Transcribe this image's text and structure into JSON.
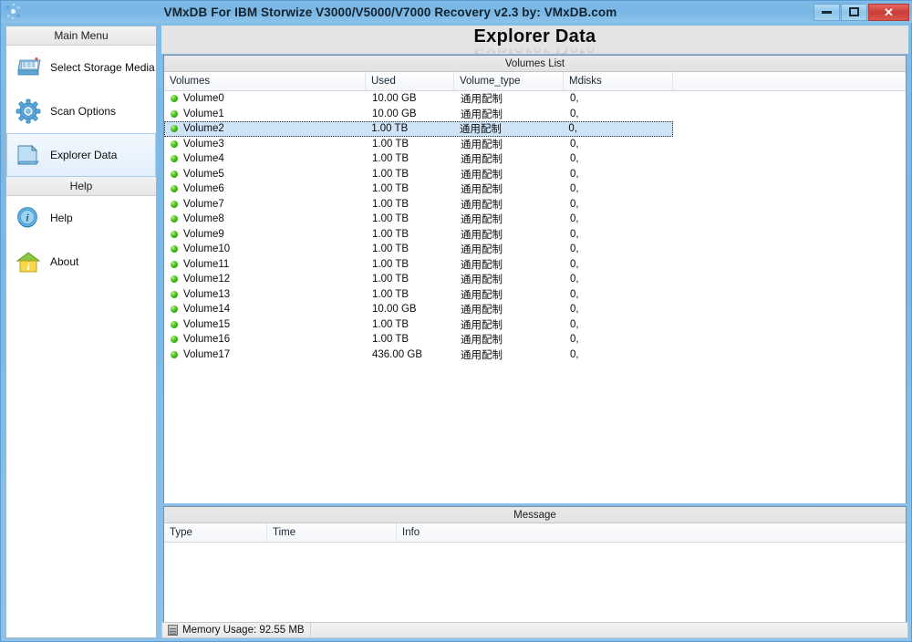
{
  "window": {
    "title": "VMxDB For IBM Storwize V3000/V5000/V7000 Recovery v2.3 by: VMxDB.com",
    "app_icon": "molecule-icon",
    "minimize_label": "Minimize",
    "maximize_label": "Maximize",
    "close_label": "Close",
    "close_glyph": "✕"
  },
  "sidebar": {
    "groups": [
      {
        "header": "Main Menu",
        "items": [
          {
            "label": "Select Storage Media",
            "icon": "storage-media-icon",
            "selected": false
          },
          {
            "label": "Scan Options",
            "icon": "gear-icon",
            "selected": false
          },
          {
            "label": "Explorer Data",
            "icon": "folder-icon",
            "selected": true
          }
        ]
      },
      {
        "header": "Help",
        "items": [
          {
            "label": "Help",
            "icon": "info-circle-icon",
            "selected": false
          },
          {
            "label": "About",
            "icon": "house-info-icon",
            "selected": false
          }
        ]
      }
    ]
  },
  "main": {
    "page_title": "Explorer Data",
    "volumes_panel": {
      "caption": "Volumes List",
      "columns": [
        "Volumes",
        "Used",
        "Volume_type",
        "Mdisks",
        ""
      ],
      "selected_row_index": 2,
      "rows": [
        {
          "volume": "Volume0",
          "used": "10.00 GB",
          "volume_type": "通用配制",
          "mdisks": "0,"
        },
        {
          "volume": "Volume1",
          "used": "10.00 GB",
          "volume_type": "通用配制",
          "mdisks": "0,"
        },
        {
          "volume": "Volume2",
          "used": "1.00 TB",
          "volume_type": "通用配制",
          "mdisks": "0,"
        },
        {
          "volume": "Volume3",
          "used": "1.00 TB",
          "volume_type": "通用配制",
          "mdisks": "0,"
        },
        {
          "volume": "Volume4",
          "used": "1.00 TB",
          "volume_type": "通用配制",
          "mdisks": "0,"
        },
        {
          "volume": "Volume5",
          "used": "1.00 TB",
          "volume_type": "通用配制",
          "mdisks": "0,"
        },
        {
          "volume": "Volume6",
          "used": "1.00 TB",
          "volume_type": "通用配制",
          "mdisks": "0,"
        },
        {
          "volume": "Volume7",
          "used": "1.00 TB",
          "volume_type": "通用配制",
          "mdisks": "0,"
        },
        {
          "volume": "Volume8",
          "used": "1.00 TB",
          "volume_type": "通用配制",
          "mdisks": "0,"
        },
        {
          "volume": "Volume9",
          "used": "1.00 TB",
          "volume_type": "通用配制",
          "mdisks": "0,"
        },
        {
          "volume": "Volume10",
          "used": "1.00 TB",
          "volume_type": "通用配制",
          "mdisks": "0,"
        },
        {
          "volume": "Volume11",
          "used": "1.00 TB",
          "volume_type": "通用配制",
          "mdisks": "0,"
        },
        {
          "volume": "Volume12",
          "used": "1.00 TB",
          "volume_type": "通用配制",
          "mdisks": "0,"
        },
        {
          "volume": "Volume13",
          "used": "1.00 TB",
          "volume_type": "通用配制",
          "mdisks": "0,"
        },
        {
          "volume": "Volume14",
          "used": "10.00 GB",
          "volume_type": "通用配制",
          "mdisks": "0,"
        },
        {
          "volume": "Volume15",
          "used": "1.00 TB",
          "volume_type": "通用配制",
          "mdisks": "0,"
        },
        {
          "volume": "Volume16",
          "used": "1.00 TB",
          "volume_type": "通用配制",
          "mdisks": "0,"
        },
        {
          "volume": "Volume17",
          "used": "436.00 GB",
          "volume_type": "通用配制",
          "mdisks": "0,"
        }
      ]
    },
    "message_panel": {
      "caption": "Message",
      "columns": [
        "Type",
        "Time",
        "Info"
      ],
      "rows": []
    }
  },
  "statusbar": {
    "memory_usage": "Memory Usage: 92.55 MB",
    "memory_icon": "memory-chip-icon"
  },
  "colors": {
    "titlebar": "#7cb8e6",
    "close_button": "#c93d36",
    "selection": "#cfe4f7",
    "led_green": "#49c31a"
  }
}
